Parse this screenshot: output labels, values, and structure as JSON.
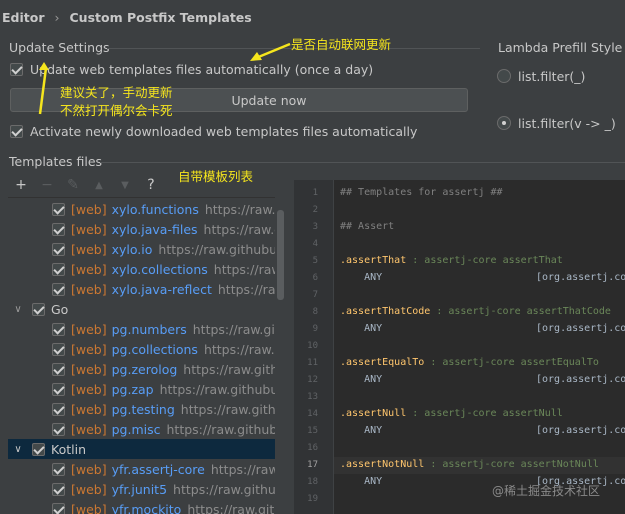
{
  "breadcrumb": {
    "root": "Editor",
    "separator": "›",
    "current": "Custom Postfix Templates"
  },
  "update_settings": {
    "title": "Update Settings",
    "update_auto_label": "Update web templates files automatically (once a day)",
    "update_auto_checked": true,
    "update_now_label": "Update now",
    "activate_label": "Activate newly downloaded web templates files automatically",
    "activate_checked": true
  },
  "lambda_prefill": {
    "title": "Lambda Prefill Style",
    "options": [
      "list.filter(_)",
      "list.filter(v -> _)"
    ],
    "selected": "list.filter(v -> _)"
  },
  "templates_files": {
    "title": "Templates files",
    "toolbar": {
      "add": "+",
      "remove": "−",
      "edit": "✎",
      "up": "▲",
      "down": "▼",
      "help": "?"
    },
    "rows": [
      {
        "web": "[web]",
        "name": "xylo.functions",
        "url": "https://raw.githubu"
      },
      {
        "web": "[web]",
        "name": "xylo.java-files",
        "url": "https://raw.githubu"
      },
      {
        "web": "[web]",
        "name": "xylo.io",
        "url": "https://raw.githubuserco"
      },
      {
        "web": "[web]",
        "name": "xylo.collections",
        "url": "https://raw.githu"
      },
      {
        "web": "[web]",
        "name": "xylo.java-reflect",
        "url": "https://raw.githu"
      },
      {
        "group": "Go"
      },
      {
        "web": "[web]",
        "name": "pg.numbers",
        "url": "https://raw.githubu"
      },
      {
        "web": "[web]",
        "name": "pg.collections",
        "url": "https://raw.github"
      },
      {
        "web": "[web]",
        "name": "pg.zerolog",
        "url": "https://raw.githubus"
      },
      {
        "web": "[web]",
        "name": "pg.zap",
        "url": "https://raw.githubusercont"
      },
      {
        "web": "[web]",
        "name": "pg.testing",
        "url": "https://raw.githubuse"
      },
      {
        "web": "[web]",
        "name": "pg.misc",
        "url": "https://raw.githubuserco"
      },
      {
        "group": "Kotlin"
      },
      {
        "web": "[web]",
        "name": "yfr.assertj-core",
        "url": "https://raw.githu"
      },
      {
        "web": "[web]",
        "name": "yfr.junit5",
        "url": "https://raw.githubuserc"
      },
      {
        "web": "[web]",
        "name": "yfr.mockito",
        "url": "https://raw.githubus"
      }
    ]
  },
  "editor": {
    "lines": [
      {
        "n": "1",
        "text": "## Templates for assertj ##"
      },
      {
        "n": "2",
        "text": ""
      },
      {
        "n": "3",
        "text": "## Assert"
      },
      {
        "n": "4",
        "text": ""
      },
      {
        "n": "5",
        "key": ".assertThat",
        "rest": " : assertj-core assertThat"
      },
      {
        "n": "6",
        "any": "    ANY",
        "imp": "[org.assertj.co"
      },
      {
        "n": "7",
        "text": ""
      },
      {
        "n": "8",
        "key": ".assertThatCode",
        "rest": " : assertj-core assertThatCode"
      },
      {
        "n": "9",
        "any": "    ANY",
        "imp": "[org.assertj.co"
      },
      {
        "n": "10",
        "text": ""
      },
      {
        "n": "11",
        "key": ".assertEqualTo",
        "rest": " : assertj-core assertEqualTo"
      },
      {
        "n": "12",
        "any": "    ANY",
        "imp": "[org.assertj.co"
      },
      {
        "n": "13",
        "text": ""
      },
      {
        "n": "14",
        "key": ".assertNull",
        "rest": " : assertj-core assertNull"
      },
      {
        "n": "15",
        "any": "    ANY",
        "imp": "[org.assertj.co"
      },
      {
        "n": "16",
        "text": ""
      },
      {
        "n": "17",
        "key": ".assertNotNull",
        "rest": " : assertj-core assertNotNull"
      },
      {
        "n": "18",
        "any": "    ANY",
        "imp": "[org.assertj.co"
      },
      {
        "n": "19",
        "text": ""
      }
    ]
  },
  "annotations": {
    "auto_update": "是否自动联网更新",
    "suggest_line1": "建议关了，手动更新",
    "suggest_line2": "不然打开偶尔会卡死",
    "builtin_list": "自带模板列表"
  },
  "watermark": "@稀土掘金技术社区",
  "colors": {
    "background": "#3c3f41",
    "editor_bg": "#2b2b2b",
    "annotation": "#f5e51d",
    "link": "#589df6",
    "web_tag": "#cc7832"
  }
}
